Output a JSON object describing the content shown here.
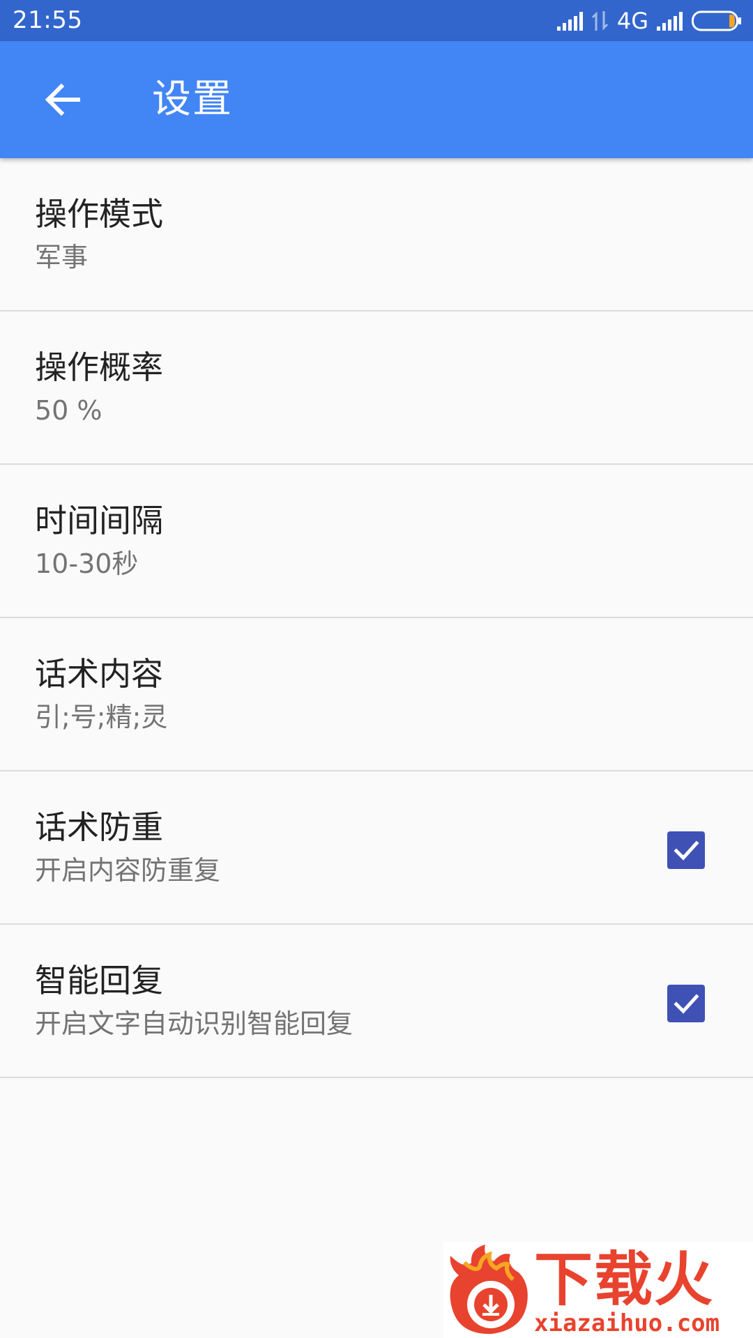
{
  "status_bar": {
    "time": "21:55",
    "network": "4G",
    "icons": [
      "signal-icon",
      "data-arrows-icon",
      "signal-icon",
      "battery-icon"
    ]
  },
  "app_bar": {
    "title": "设置",
    "back_icon": "arrow-back-icon"
  },
  "settings": [
    {
      "title": "操作模式",
      "summary": "军事"
    },
    {
      "title": "操作概率",
      "summary": "50 %"
    },
    {
      "title": "时间间隔",
      "summary": "10-30秒"
    },
    {
      "title": "话术内容",
      "summary": "引;号;精;灵"
    },
    {
      "title": "话术防重",
      "summary": "开启内容防重复",
      "checked": true
    },
    {
      "title": "智能回复",
      "summary": "开启文字自动识别智能回复",
      "checked": true
    }
  ],
  "watermark": {
    "brand": "下载火",
    "domain": "xiazaihuo.com"
  },
  "colors": {
    "status_bar": "#3366cc",
    "app_bar": "#4285f4",
    "checkbox": "#3f51b5",
    "watermark": "#e8432e"
  }
}
